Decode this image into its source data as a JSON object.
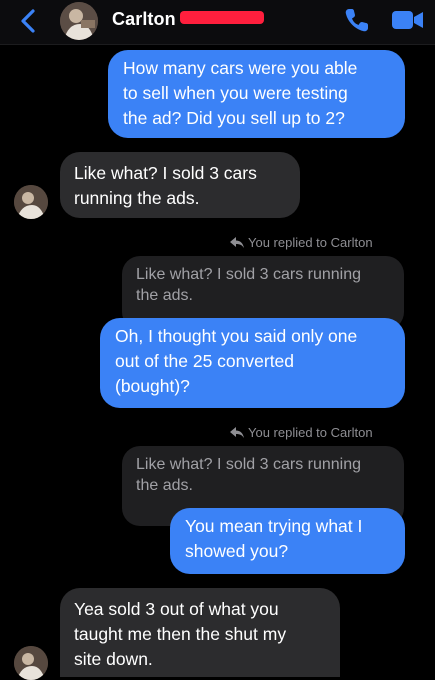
{
  "header": {
    "contact_name": "Carlton",
    "back_icon": "chevron-left-icon",
    "call_icon": "phone-icon",
    "video_icon": "video-camera-icon",
    "accent_color": "#3b82f6",
    "redaction_color": "#ff1f3d"
  },
  "messages": [
    {
      "direction": "outgoing",
      "text": "How many cars were you able\nto sell when you were testing\nthe ad? Did you sell up to 2?"
    },
    {
      "direction": "incoming",
      "text": "Like what? I sold 3 cars\nrunning the ads."
    },
    {
      "direction": "outgoing",
      "reply_note": "You replied to Carlton",
      "quoted": "Like what? I sold 3 cars running\nthe ads.",
      "text": "Oh, I thought you said only one\nout of the 25 converted\n(bought)?"
    },
    {
      "direction": "outgoing",
      "reply_note": "You replied to Carlton",
      "quoted": "Like what? I sold 3 cars running\nthe ads.",
      "text": "You mean trying what I\nshowed you?"
    },
    {
      "direction": "incoming",
      "text": "Yea  sold 3 out of what you\ntaught me then the shut my\nsite down."
    }
  ]
}
